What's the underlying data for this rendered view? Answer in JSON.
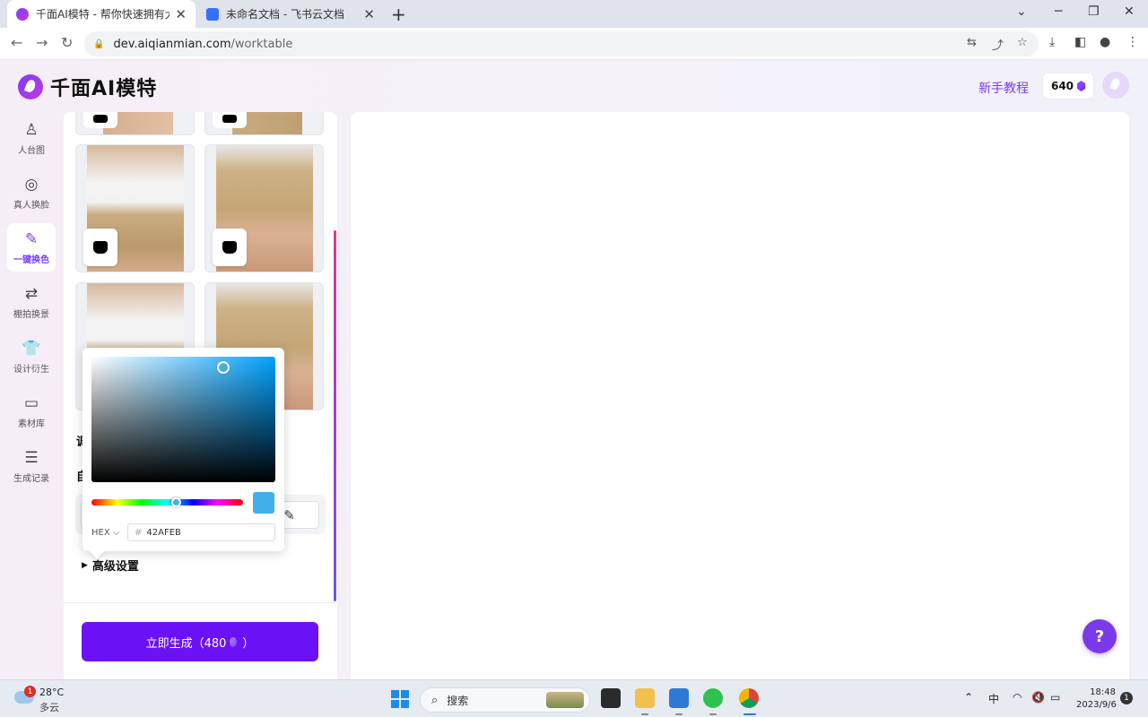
{
  "browser": {
    "tabs": [
      {
        "title": "千面AI模特 - 帮你快速拥有大牌同",
        "close": "✕"
      },
      {
        "title": "未命名文档 - 飞书云文档",
        "close": "✕"
      }
    ],
    "new_tab": "+",
    "url_host": "dev.aiqianmian.com",
    "url_path": "/worktable"
  },
  "header": {
    "brand": "千面AI模特",
    "tutorial": "新手教程",
    "credits": "640"
  },
  "sidebar": {
    "items": [
      {
        "label": "人台图",
        "icon": "♙"
      },
      {
        "label": "真人换脸",
        "icon": "◎"
      },
      {
        "label": "一键换色",
        "icon": "✎"
      },
      {
        "label": "棚拍换景",
        "icon": "⇄"
      },
      {
        "label": "设计衍生",
        "icon": "👕"
      },
      {
        "label": "素材库",
        "icon": "▭"
      },
      {
        "label": "生成记录",
        "icon": "☰"
      }
    ]
  },
  "panel": {
    "partial_label_1": "调",
    "partial_label_2": "自",
    "color_value": "#42afeb",
    "eyedropper_icon": "✎",
    "advanced": "高级设置",
    "generate_label": "立即生成（480",
    "generate_suffix": "）"
  },
  "picker": {
    "format": "HEX",
    "format_caret": "⌵",
    "hex_hash": "#",
    "hex": "42AFEB",
    "color": "#42afeb"
  },
  "help": "?",
  "taskbar": {
    "weather_badge": "1",
    "temp": "28°C",
    "weather": "多云",
    "search": "搜索",
    "ime": "中",
    "time": "18:48",
    "date": "2023/9/6",
    "notifications": "1"
  }
}
